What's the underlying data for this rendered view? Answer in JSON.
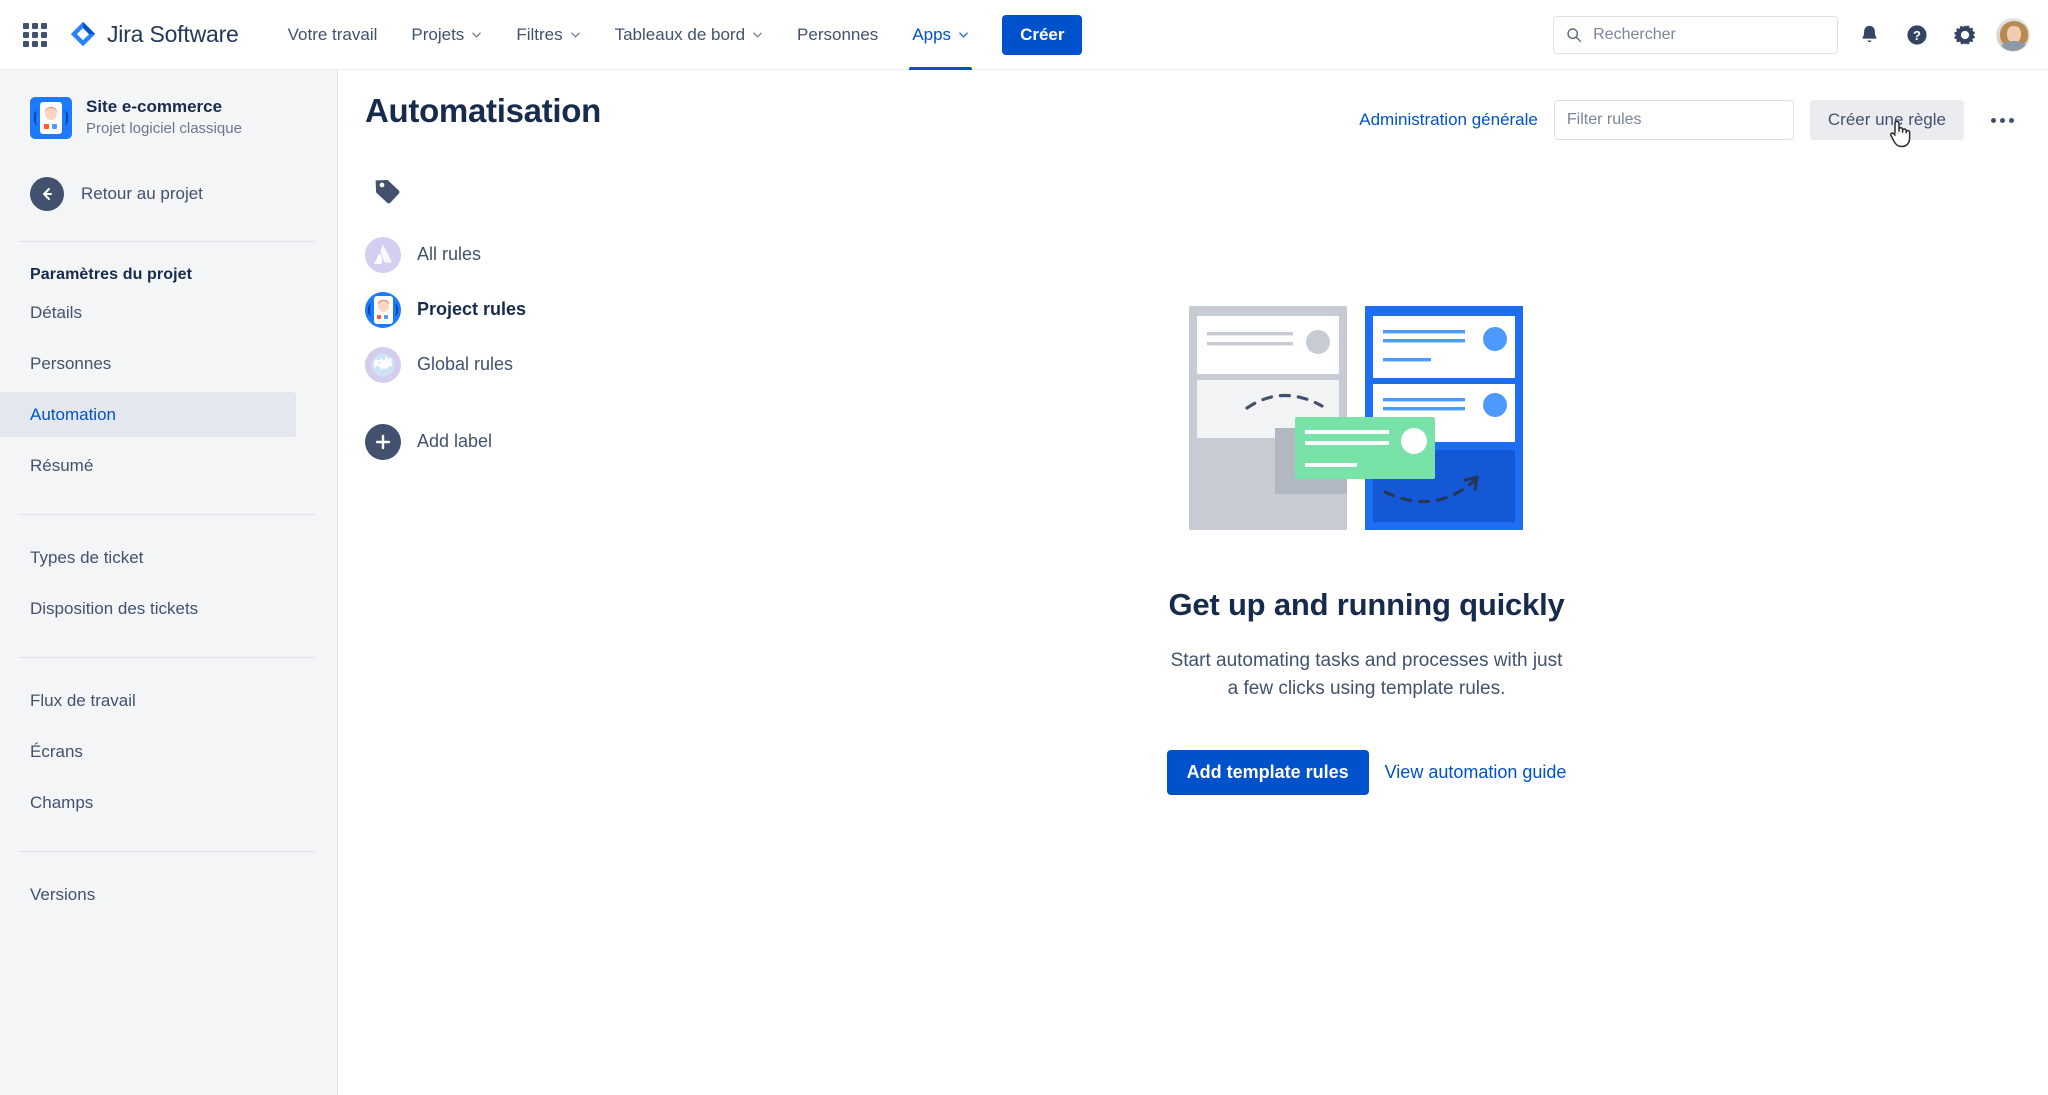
{
  "topnav": {
    "app_switcher_icon": "grid-apps-icon",
    "brand": {
      "logo_icon": "jira-diamond-logo",
      "name": "Jira Software"
    },
    "items": [
      {
        "label": "Votre travail",
        "has_caret": false,
        "active": false
      },
      {
        "label": "Projets",
        "has_caret": true,
        "active": false
      },
      {
        "label": "Filtres",
        "has_caret": true,
        "active": false
      },
      {
        "label": "Tableaux de bord",
        "has_caret": true,
        "active": false
      },
      {
        "label": "Personnes",
        "has_caret": false,
        "active": false
      },
      {
        "label": "Apps",
        "has_caret": true,
        "active": true
      }
    ],
    "create_label": "Créer",
    "search": {
      "placeholder": "Rechercher",
      "value": "",
      "icon": "search-icon"
    },
    "icons": [
      "notifications-bell-icon",
      "help-question-icon",
      "settings-gear-icon"
    ],
    "avatar": "user-avatar"
  },
  "sidebar": {
    "project": {
      "name": "Site e-commerce",
      "type": "Projet logiciel classique",
      "avatar_icon": "project-avatar-icon"
    },
    "back": {
      "label": "Retour au projet",
      "icon": "arrow-left-circle-icon"
    },
    "section_title": "Paramètres du projet",
    "group1": [
      {
        "label": "Détails",
        "selected": false
      },
      {
        "label": "Personnes",
        "selected": false
      },
      {
        "label": "Automation",
        "selected": true
      },
      {
        "label": "Résumé",
        "selected": false
      }
    ],
    "group2": [
      {
        "label": "Types de ticket",
        "selected": false
      },
      {
        "label": "Disposition des tickets",
        "selected": false
      }
    ],
    "group3": [
      {
        "label": "Flux de travail",
        "selected": false
      },
      {
        "label": "Écrans",
        "selected": false
      },
      {
        "label": "Champs",
        "selected": false
      }
    ],
    "group4": [
      {
        "label": "Versions",
        "selected": false
      }
    ]
  },
  "main": {
    "page_title": "Automatisation",
    "admin_link": "Administration générale",
    "filter": {
      "placeholder": "Filter rules",
      "value": ""
    },
    "create_rule_label": "Créer une règle",
    "more_actions_icon": "more-horizontal-icon",
    "label_rail": {
      "tag_icon": "tag-label-icon",
      "items": [
        {
          "label": "All rules",
          "icon": "atlassian-logo-icon",
          "current": false
        },
        {
          "label": "Project rules",
          "icon": "project-avatar-icon",
          "current": true
        },
        {
          "label": "Global rules",
          "icon": "globe-icon",
          "current": false
        }
      ],
      "add_label": {
        "label": "Add label",
        "icon": "plus-circle-icon"
      }
    },
    "empty_state": {
      "illustration": "automation-rules-illustration",
      "title": "Get up and running quickly",
      "subtitle": "Start automating tasks and processes with just a few clicks using template rules.",
      "primary_button": "Add template rules",
      "secondary_link": "View automation guide"
    }
  },
  "colors": {
    "brand_blue": "#0052cc",
    "nav_text": "#42526e",
    "heading": "#172b4d",
    "sidebar_bg": "#f4f5f7",
    "selected_bg": "#e4e7ed",
    "illustration_blue": "#1d6ef5",
    "illustration_green": "#79e2a8"
  }
}
